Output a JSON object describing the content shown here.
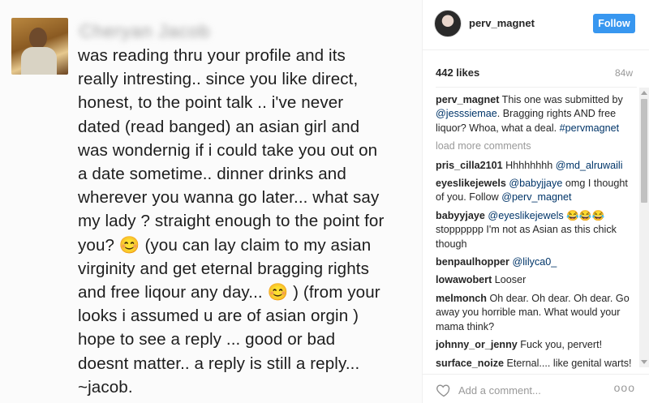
{
  "post_image": {
    "sender_name": "Cheryan Jacob",
    "message_text": "was reading thru your profile and its\nreally intresting.. since you like direct,\nhonest, to the point talk .. i've never\ndated (read banged) an asian girl and\nwas wondernig if i could take you out on\na date sometime.. dinner drinks and\nwherever you wanna go later... what say\nmy lady ? straight enough to the point for\nyou? 😊 (you can lay claim to my asian\nvirginity and get eternal bragging rights\nand free liqour any day... 😊 ) (from your\nlooks i assumed u are of asian orgin )\nhope to see a reply ... good or bad\ndoesnt matter.. a reply is still a reply...\n~jacob."
  },
  "header": {
    "username": "perv_magnet",
    "follow_label": "Follow"
  },
  "stats": {
    "likes": "442 likes",
    "age": "84w"
  },
  "caption": {
    "user": "perv_magnet",
    "text_1": " This one was submitted by ",
    "mention": "@jesssiemae",
    "text_2": ". Bragging rights AND free liquor? Whoa, what a deal. ",
    "hashtag": "#pervmagnet"
  },
  "load_more_label": "load more comments",
  "comments": [
    {
      "user": "pris_cilla2101",
      "before": " Hhhhhhhh ",
      "link": "@md_alruwaili",
      "after": ""
    },
    {
      "user": "eyeslikejewels",
      "before": " ",
      "link": "@babyjjaye",
      "after": " omg I thought of you. Follow ",
      "link2": "@perv_magnet",
      "after2": ""
    },
    {
      "user": "babyyjaye",
      "before": " ",
      "link": "@eyeslikejewels",
      "after": " 😂😂😂 stopppppp I'm not as Asian as this chick though"
    },
    {
      "user": "benpaulhopper",
      "before": " ",
      "link": "@lilyca0_",
      "after": ""
    },
    {
      "user": "lowawobert",
      "before": " Looser",
      "link": "",
      "after": ""
    },
    {
      "user": "melmonch",
      "before": " Oh dear. Oh dear. Oh dear. Go away you horrible man. What would your mama think?",
      "link": "",
      "after": ""
    },
    {
      "user": "johnny_or_jenny",
      "before": " Fuck you, pervert!",
      "link": "",
      "after": ""
    },
    {
      "user": "surface_noize",
      "before": " Eternal.... like genital warts!",
      "link": "",
      "after": ""
    }
  ],
  "footer": {
    "comment_placeholder": "Add a comment...",
    "more_label": "ooo"
  }
}
